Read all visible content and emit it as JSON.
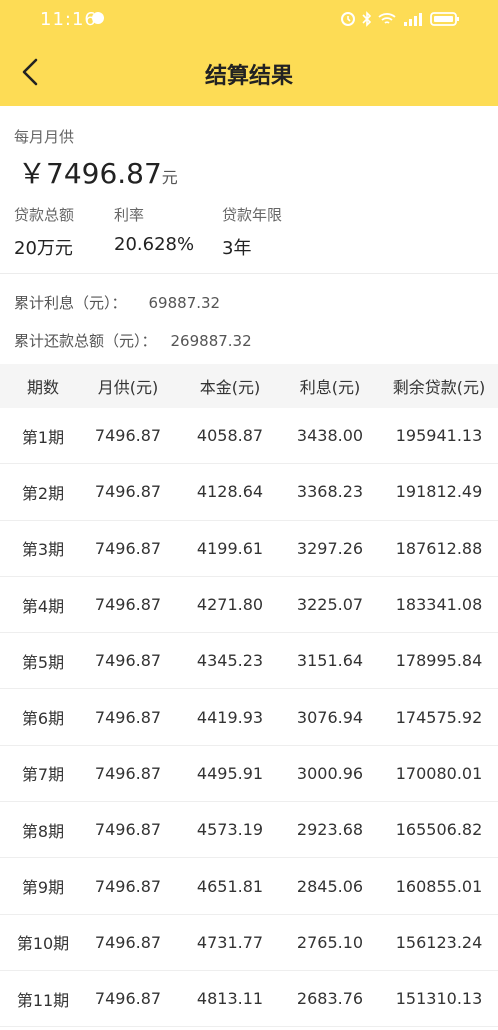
{
  "status": {
    "time": "11:16"
  },
  "header": {
    "title": "结算结果"
  },
  "summary": {
    "monthly_label": "每月月供",
    "monthly_amount": "￥7496.87",
    "monthly_unit": "元",
    "loan_label": "贷款总额",
    "loan_value": "20万元",
    "rate_label": "利率",
    "rate_value": "20.628%",
    "term_label": "贷款年限",
    "term_value": "3年"
  },
  "accumulated": {
    "interest_label": "累计利息（元）：",
    "interest_value": "69887.32",
    "total_label": "累计还款总额（元）：",
    "total_value": "269887.32"
  },
  "table": {
    "headers": [
      "期数",
      "月供(元)",
      "本金(元)",
      "利息(元)",
      "剩余贷款(元)"
    ],
    "rows": [
      [
        "第1期",
        "7496.87",
        "4058.87",
        "3438.00",
        "195941.13"
      ],
      [
        "第2期",
        "7496.87",
        "4128.64",
        "3368.23",
        "191812.49"
      ],
      [
        "第3期",
        "7496.87",
        "4199.61",
        "3297.26",
        "187612.88"
      ],
      [
        "第4期",
        "7496.87",
        "4271.80",
        "3225.07",
        "183341.08"
      ],
      [
        "第5期",
        "7496.87",
        "4345.23",
        "3151.64",
        "178995.84"
      ],
      [
        "第6期",
        "7496.87",
        "4419.93",
        "3076.94",
        "174575.92"
      ],
      [
        "第7期",
        "7496.87",
        "4495.91",
        "3000.96",
        "170080.01"
      ],
      [
        "第8期",
        "7496.87",
        "4573.19",
        "2923.68",
        "165506.82"
      ],
      [
        "第9期",
        "7496.87",
        "4651.81",
        "2845.06",
        "160855.01"
      ],
      [
        "第10期",
        "7496.87",
        "4731.77",
        "2765.10",
        "156123.24"
      ],
      [
        "第11期",
        "7496.87",
        "4813.11",
        "2683.76",
        "151310.13"
      ]
    ]
  },
  "colors": {
    "accent": "#fddc55"
  }
}
